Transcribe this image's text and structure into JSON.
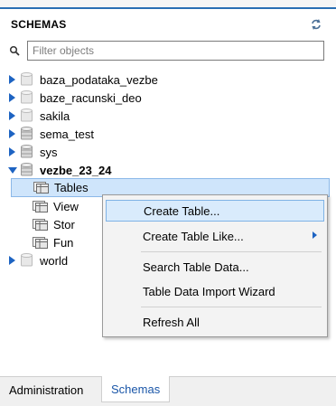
{
  "header": {
    "title": "SCHEMAS",
    "refresh_icon": "refresh-icon"
  },
  "filter": {
    "placeholder": "Filter objects",
    "value": "",
    "search_icon": "search-icon"
  },
  "tree": {
    "schemas": [
      {
        "label": "baza_podataka_vezbe",
        "expanded": false
      },
      {
        "label": "baze_racunski_deo",
        "expanded": false
      },
      {
        "label": "sakila",
        "expanded": false
      },
      {
        "label": "sema_test",
        "expanded": false
      },
      {
        "label": "sys",
        "expanded": false
      },
      {
        "label": "vezbe_23_24",
        "expanded": true,
        "bold": true
      },
      {
        "label": "world",
        "expanded": false
      }
    ],
    "children": [
      {
        "label": "Tables",
        "selected": true
      },
      {
        "label": "View"
      },
      {
        "label": "Stor"
      },
      {
        "label": "Fun"
      }
    ]
  },
  "context_menu": {
    "items": [
      {
        "label": "Create Table...",
        "hover": true
      },
      {
        "label": "Create Table Like...",
        "submenu": true
      },
      {
        "label": "Search Table Data..."
      },
      {
        "label": "Table Data Import Wizard"
      },
      {
        "label": "Refresh All"
      }
    ]
  },
  "tabs": [
    {
      "label": "Administration",
      "active": false
    },
    {
      "label": "Schemas",
      "active": true
    }
  ],
  "colors": {
    "accent": "#2a6fb4",
    "selection": "#cfe5fb",
    "menu_hover": "#d9ebfc",
    "submenu_arrow": "#1d63c2"
  }
}
